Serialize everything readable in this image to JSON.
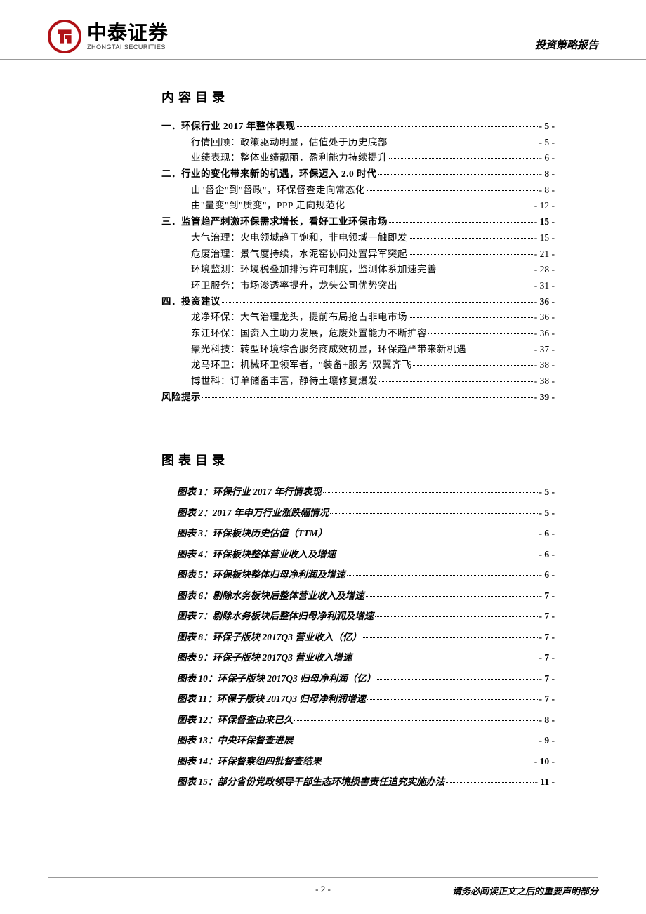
{
  "header": {
    "logo_cn": "中泰证券",
    "logo_en": "ZHONGTAI SECURITIES",
    "right": "投资策略报告"
  },
  "toc_title": "内容目录",
  "toc": [
    {
      "level": 0,
      "label": "一．环保行业 2017 年整体表现",
      "page": "- 5 -"
    },
    {
      "level": 1,
      "label": "行情回顾：政策驱动明显，估值处于历史底部",
      "page": "- 5 -"
    },
    {
      "level": 1,
      "label": "业绩表现：整体业绩靓丽，盈利能力持续提升",
      "page": "- 6 -"
    },
    {
      "level": 0,
      "label": "二．行业的变化带来新的机遇，环保迈入 2.0 时代",
      "page": "- 8 -"
    },
    {
      "level": 1,
      "label": "由\"督企\"到\"督政\"，环保督查走向常态化",
      "page": "- 8 -"
    },
    {
      "level": 1,
      "label": "由\"量变\"到\"质变\"，PPP 走向规范化",
      "page": "- 12 -"
    },
    {
      "level": 0,
      "label": "三．监管趋严刺激环保需求增长，看好工业环保市场",
      "page": "- 15 -"
    },
    {
      "level": 1,
      "label": "大气治理：火电领域趋于饱和，非电领域一触即发",
      "page": "- 15 -"
    },
    {
      "level": 1,
      "label": "危废治理：景气度持续，水泥窑协同处置异军突起",
      "page": "- 21 -"
    },
    {
      "level": 1,
      "label": "环境监测：环境税叠加排污许可制度，监测体系加速完善",
      "page": "- 28 -"
    },
    {
      "level": 1,
      "label": "环卫服务：市场渗透率提升，龙头公司优势突出",
      "page": "- 31 -"
    },
    {
      "level": 0,
      "label": "四．投资建议",
      "page": "- 36 -"
    },
    {
      "level": 1,
      "label": "龙净环保：大气治理龙头，提前布局抢占非电市场",
      "page": "- 36 -"
    },
    {
      "level": 1,
      "label": "东江环保：国资入主助力发展，危废处置能力不断扩容",
      "page": "- 36 -"
    },
    {
      "level": 1,
      "label": "聚光科技：转型环境综合服务商成效初显，环保趋严带来新机遇",
      "page": "- 37 -"
    },
    {
      "level": 1,
      "label": "龙马环卫：机械环卫领军者，\"装备+服务\"双翼齐飞",
      "page": "- 38 -"
    },
    {
      "level": 1,
      "label": "博世科：订单储备丰富，静待土壤修复爆发",
      "page": "- 38 -"
    },
    {
      "level": 0,
      "label": "风险提示",
      "page": "- 39 -"
    }
  ],
  "fig_title": "图表目录",
  "figures": [
    {
      "label": "图表 1：环保行业 2017 年行情表现",
      "page": "- 5 -"
    },
    {
      "label": "图表 2：2017 年申万行业涨跌幅情况",
      "page": "- 5 -"
    },
    {
      "label": "图表 3：环保板块历史估值（TTM）",
      "page": "- 6 -"
    },
    {
      "label": "图表 4：环保板块整体营业收入及增速",
      "page": "- 6 -"
    },
    {
      "label": "图表 5：环保板块整体归母净利润及增速",
      "page": "- 6 -"
    },
    {
      "label": "图表 6：剔除水务板块后整体营业收入及增速",
      "page": "- 7 -"
    },
    {
      "label": "图表 7：剔除水务板块后整体归母净利润及增速",
      "page": "- 7 -"
    },
    {
      "label": "图表 8：环保子版块 2017Q3 营业收入（亿）",
      "page": "- 7 -"
    },
    {
      "label": "图表 9：环保子版块 2017Q3 营业收入增速",
      "page": "- 7 -"
    },
    {
      "label": "图表 10：环保子版块 2017Q3 归母净利润（亿）",
      "page": "- 7 -"
    },
    {
      "label": "图表 11：环保子版块 2017Q3 归母净利润增速",
      "page": "- 7 -"
    },
    {
      "label": "图表 12：环保督查由来已久",
      "page": "- 8 -"
    },
    {
      "label": "图表 13：中央环保督查进展",
      "page": "- 9 -"
    },
    {
      "label": "图表 14：环保督察组四批督查结果",
      "page": "- 10 -"
    },
    {
      "label": "图表 15：部分省份党政领导干部生态环境损害责任追究实施办法",
      "page": "- 11 -"
    }
  ],
  "footer": {
    "center": "- 2 -",
    "right": "请务必阅读正文之后的重要声明部分"
  }
}
